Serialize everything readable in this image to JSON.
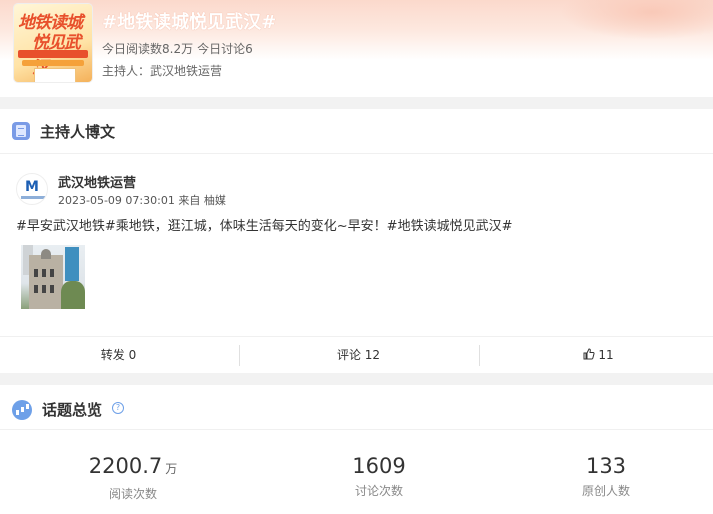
{
  "topic": {
    "title": "#地铁读城悦见武汉#",
    "read_stat": "今日阅读数8.2万",
    "discuss_stat": "今日讨论6",
    "host": "主持人：武汉地铁运营",
    "cover_text_1": "地铁读城",
    "cover_text_2": "悦见武汉"
  },
  "host_posts": {
    "section_title": "主持人博文",
    "post": {
      "author": "武汉地铁运营",
      "meta": "2023-05-09 07:30:01 来自 柚媒",
      "text": "#早安武汉地铁#乘地铁，逛江城，体味生活每天的变化~早安！#地铁读城悦见武汉#",
      "actions": {
        "repost": "转发 0",
        "comment": "评论 12",
        "like": "11"
      }
    }
  },
  "overview": {
    "section_title": "话题总览",
    "stats": [
      {
        "value": "2200.7",
        "unit": "万",
        "label": "阅读次数"
      },
      {
        "value": "1609",
        "unit": "",
        "label": "讨论次数"
      },
      {
        "value": "133",
        "unit": "",
        "label": "原创人数"
      }
    ]
  }
}
